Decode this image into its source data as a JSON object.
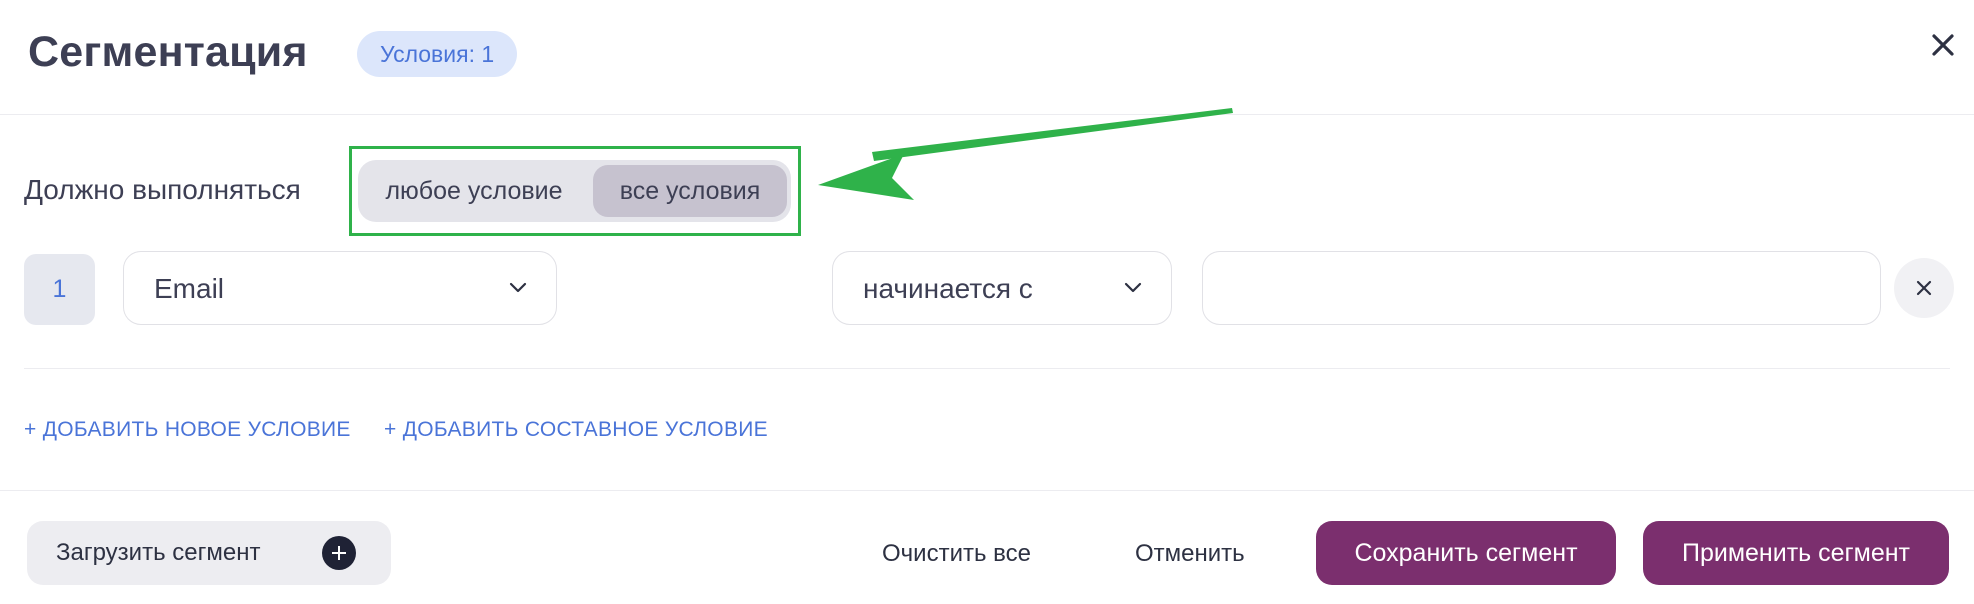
{
  "header": {
    "title": "Сегментация",
    "conditions_badge": "Условия: 1"
  },
  "match": {
    "label": "Должно выполняться",
    "options": [
      "любое условие",
      "все условия"
    ],
    "selected": "все условия"
  },
  "conditions": [
    {
      "number": "1",
      "field": "Email",
      "operator": "начинается с",
      "value": ""
    }
  ],
  "actions": {
    "add_condition": "+ ДОБАВИТЬ НОВОЕ УСЛОВИЕ",
    "add_composite": "+ ДОБАВИТЬ СОСТАВНОЕ УСЛОВИЕ"
  },
  "footer": {
    "load_segment": "Загрузить сегмент",
    "clear_all": "Очистить все",
    "cancel": "Отменить",
    "save_segment": "Сохранить сегмент",
    "apply_segment": "Применить сегмент"
  },
  "colors": {
    "accent": "#7b2f6e",
    "link": "#4a74d8",
    "highlight": "#2fb24a"
  },
  "icons": {
    "close": "close-icon",
    "chevron": "chevron-down-icon",
    "remove": "remove-condition-icon",
    "plus": "plus-circle-icon",
    "annotation": "green-arrow-annotation"
  }
}
